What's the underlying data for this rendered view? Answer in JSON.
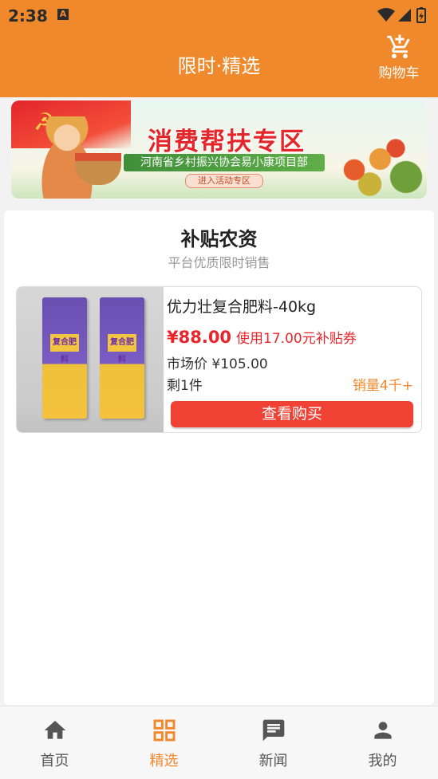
{
  "status_bar": {
    "time": "2:38",
    "notification_icon": "a-icon"
  },
  "app_bar": {
    "title": "限时·精选",
    "cart_label": "购物车"
  },
  "banner": {
    "title": "消费帮扶专区",
    "subtitle": "河南省乡村振兴协会易小康项目部",
    "cta": "进入活动专区"
  },
  "section": {
    "title": "补贴农资",
    "subtitle": "平台优质限时销售"
  },
  "product": {
    "name": "优力壮复合肥料-40kg",
    "price": "¥88.00",
    "subsidy": "使用17.00元补贴券",
    "market_price": "市场价 ¥105.00",
    "stock": "剩1件",
    "sales": "销量4千+",
    "buy_label": "查看购买",
    "bag_label": "复合肥料"
  },
  "bottom_nav": {
    "items": [
      {
        "label": "首页",
        "icon": "home-icon",
        "active": false
      },
      {
        "label": "精选",
        "icon": "grid-icon",
        "active": true
      },
      {
        "label": "新闻",
        "icon": "message-icon",
        "active": false
      },
      {
        "label": "我的",
        "icon": "person-icon",
        "active": false
      }
    ]
  },
  "colors": {
    "accent": "#f0892c",
    "price_red": "#e9242a",
    "button_red": "#ef4235"
  }
}
